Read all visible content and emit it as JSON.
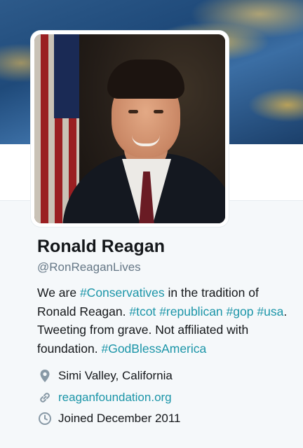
{
  "profile": {
    "name": "Ronald Reagan",
    "handle": "@RonReaganLives",
    "bio": [
      {
        "text": "We are ",
        "tag": false
      },
      {
        "text": "#Conservatives",
        "tag": true
      },
      {
        "text": " in the tradition of Ronald Reagan. ",
        "tag": false
      },
      {
        "text": "#tcot",
        "tag": true
      },
      {
        "text": " ",
        "tag": false
      },
      {
        "text": "#republican",
        "tag": true
      },
      {
        "text": " ",
        "tag": false
      },
      {
        "text": "#gop",
        "tag": true
      },
      {
        "text": " ",
        "tag": false
      },
      {
        "text": "#usa",
        "tag": true
      },
      {
        "text": ". Tweeting from grave. Not affiliated with foundation. ",
        "tag": false
      },
      {
        "text": "#GodBlessAmerica",
        "tag": true
      }
    ],
    "location": "Simi Valley, California",
    "website": "reaganfoundation.org",
    "joined": "Joined December 2011"
  },
  "icons": {
    "location": "location-pin-icon",
    "website": "link-icon",
    "joined": "calendar-clock-icon"
  },
  "colors": {
    "accent": "#1b95a8",
    "text": "#14171a",
    "muted": "#657786",
    "background": "#f5f8fa"
  }
}
